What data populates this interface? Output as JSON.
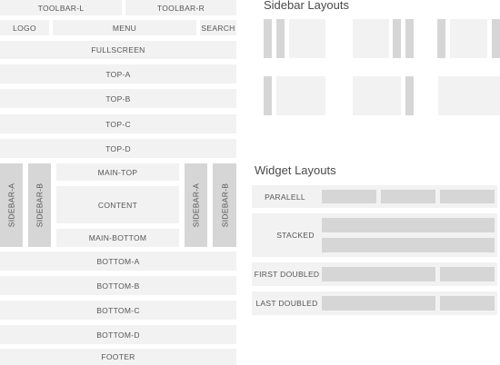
{
  "layout": {
    "toolbar_left": "TOOLBAR-L",
    "toolbar_right": "TOOLBAR-R",
    "logo": "LOGO",
    "menu": "MENU",
    "search": "SEARCH",
    "fullscreen": "FULLSCREEN",
    "top": [
      "TOP-A",
      "TOP-B",
      "TOP-C",
      "TOP-D"
    ],
    "sidebar_a": "SIDEBAR-A",
    "sidebar_b": "SIDEBAR-B",
    "main_top": "MAIN-TOP",
    "content": "CONTENT",
    "main_bottom": "MAIN-BOTTOM",
    "bottom": [
      "BOTTOM-A",
      "BOTTOM-B",
      "BOTTOM-C",
      "BOTTOM-D"
    ],
    "footer": "FOOTER"
  },
  "sidebar_layouts": {
    "title": "Sidebar Layouts"
  },
  "widget_layouts": {
    "title": "Widget Layouts",
    "rows": [
      "PARALELL",
      "STACKED",
      "FIRST DOUBLED",
      "LAST DOUBLED"
    ]
  },
  "colors": {
    "light_block": "#f2f2f2",
    "dark_block": "#d6d6d6"
  }
}
